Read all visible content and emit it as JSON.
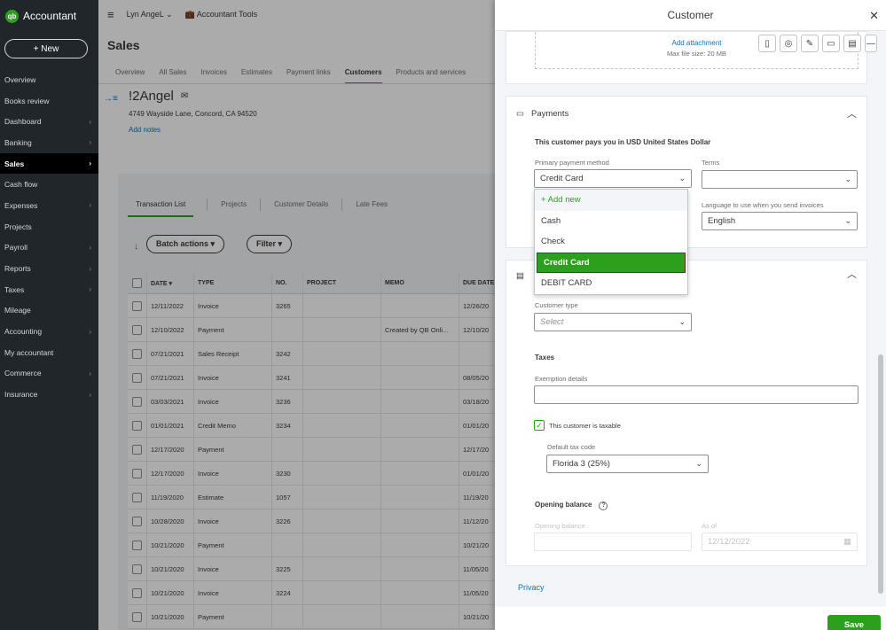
{
  "brand": {
    "logo_text": "qb",
    "name": "Accountant"
  },
  "nav": {
    "new_label": "+ New",
    "items": [
      {
        "label": "Overview",
        "chevron": ""
      },
      {
        "label": "Books review",
        "chevron": ""
      },
      {
        "label": "Dashboard",
        "chevron": "›"
      },
      {
        "label": "Banking",
        "chevron": "›"
      },
      {
        "label": "Sales",
        "chevron": "›"
      },
      {
        "label": "Cash flow",
        "chevron": ""
      },
      {
        "label": "Expenses",
        "chevron": "›"
      },
      {
        "label": "Projects",
        "chevron": ""
      },
      {
        "label": "Payroll",
        "chevron": "›"
      },
      {
        "label": "Reports",
        "chevron": "›"
      },
      {
        "label": "Taxes",
        "chevron": "›"
      },
      {
        "label": "Mileage",
        "chevron": ""
      },
      {
        "label": "Accounting",
        "chevron": "›"
      },
      {
        "label": "My accountant",
        "chevron": ""
      },
      {
        "label": "Commerce",
        "chevron": "›"
      },
      {
        "label": "Insurance",
        "chevron": "›"
      }
    ]
  },
  "topbar": {
    "user": "Lyn AngeL",
    "user_caret": "⌄",
    "tools": "Accountant Tools",
    "hamburger": "≡",
    "briefcase": "💼"
  },
  "page": {
    "title": "Sales",
    "tabs": [
      "Overview",
      "All Sales",
      "Invoices",
      "Estimates",
      "Payment links",
      "Customers",
      "Products and services"
    ]
  },
  "customer": {
    "name": "!2Angel",
    "address": "4749 Wayside Lane, Concord, CA 94520",
    "add_notes": "Add notes",
    "sidebar_icon": "→≡",
    "mail_icon": "✉"
  },
  "subtabs": [
    "Transaction List",
    "Projects",
    "Customer Details",
    "Late Fees"
  ],
  "toolbar": {
    "batch_label": "Batch actions ▾",
    "filter_label": "Filter ▾",
    "sort_icon": "↓"
  },
  "table": {
    "headers": [
      "DATE ▾",
      "TYPE",
      "NO.",
      "PROJECT",
      "MEMO",
      "DUE DATE"
    ],
    "rows": [
      [
        "12/11/2022",
        "Invoice",
        "3265",
        "",
        "",
        "12/26/20"
      ],
      [
        "12/10/2022",
        "Payment",
        "",
        "",
        "Created by QB Onli...",
        "12/10/20"
      ],
      [
        "07/21/2021",
        "Sales Receipt",
        "3242",
        "",
        "",
        ""
      ],
      [
        "07/21/2021",
        "Invoice",
        "3241",
        "",
        "",
        "08/05/20"
      ],
      [
        "03/03/2021",
        "Invoice",
        "3236",
        "",
        "",
        "03/18/20"
      ],
      [
        "01/01/2021",
        "Credit Memo",
        "3234",
        "",
        "",
        "01/01/20"
      ],
      [
        "12/17/2020",
        "Payment",
        "",
        "",
        "",
        "12/17/20"
      ],
      [
        "12/17/2020",
        "Invoice",
        "3230",
        "",
        "",
        "01/01/20"
      ],
      [
        "11/19/2020",
        "Estimate",
        "1057",
        "",
        "",
        "11/19/20"
      ],
      [
        "10/28/2020",
        "Invoice",
        "3226",
        "",
        "",
        "11/12/20"
      ],
      [
        "10/21/2020",
        "Payment",
        "",
        "",
        "",
        "10/21/20"
      ],
      [
        "10/21/2020",
        "Invoice",
        "3225",
        "",
        "",
        "11/05/20"
      ],
      [
        "10/21/2020",
        "Invoice",
        "3224",
        "",
        "",
        "11/05/20"
      ],
      [
        "10/21/2020",
        "Payment",
        "",
        "",
        "",
        "10/21/20"
      ]
    ]
  },
  "drawer": {
    "title": "Customer",
    "close": "✕",
    "attach_link": "Add attachment",
    "attach_hint": "Max file size: 20 MB",
    "toolbar_icons": [
      "▯",
      "◎",
      "✎",
      "▭",
      "▤"
    ],
    "minimize": "—",
    "payments": {
      "title": "Payments",
      "icon": "▭",
      "caret": "︿",
      "pays_in": "This customer pays you in USD United States Dollar",
      "method_label": "Primary payment method",
      "method_value": "Credit Card",
      "terms_label": "Terms",
      "terms_value": "",
      "language_label": "Language to use when you send invoices",
      "language_value": "English"
    },
    "dropdown": {
      "add_new": "+ Add new",
      "options": [
        "Cash",
        "Check",
        "Credit Card",
        "DEBIT CARD"
      ],
      "selected": "Credit Card"
    },
    "additional": {
      "icon": "▤",
      "caret": "︿",
      "customer_type_label": "Customer type",
      "customer_type_placeholder": "Select",
      "taxes_heading": "Taxes",
      "exemption_label": "Exemption details",
      "taxable_label": "This customer is taxable",
      "taxable_check": "✓",
      "tax_code_label": "Default tax code",
      "tax_code_value": "Florida 3 (25%)",
      "opening_heading": "Opening balance",
      "help_icon": "?",
      "opening_label": "Opening balance",
      "as_of_label": "As of",
      "as_of_value": "12/12/2022",
      "calendar_icon": "▦"
    },
    "privacy": "Privacy",
    "save": "Save",
    "arrow_down": "⌄"
  },
  "colors": {
    "brand_green": "#2ca01c",
    "nav_bg": "#21262a",
    "link_blue": "#0077c5"
  }
}
